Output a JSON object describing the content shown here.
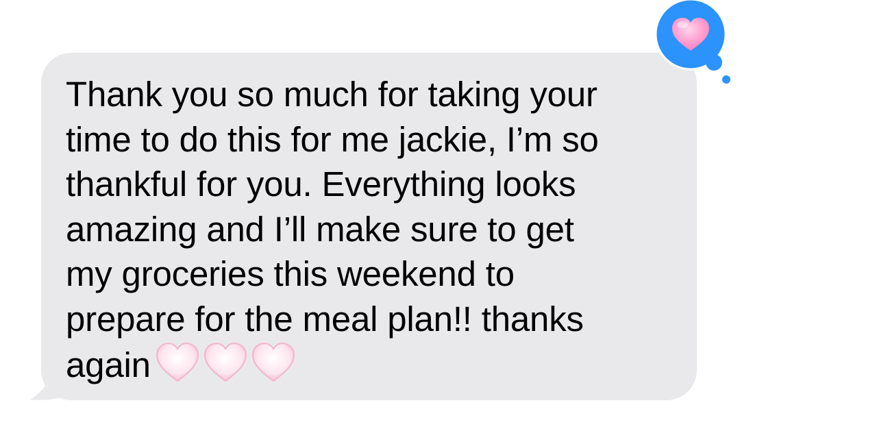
{
  "message": {
    "sender": "incoming",
    "lines": [
      "Thank you so much for taking your",
      "time to do this for me jackie, I’m so",
      "thankful for you. Everything looks",
      "amazing and I’ll make sure to get",
      "my groceries this weekend to",
      "prepare for the meal plan!! thanks",
      "again"
    ],
    "emoji": [
      "pink-heart-icon",
      "pink-heart-icon",
      "pink-heart-icon"
    ],
    "bubble_color": "#e9e9eb",
    "text_color": "#000000"
  },
  "tapback": {
    "reaction": "heart-icon",
    "badge_color": "#2b93fb",
    "heart_color": "#ff8fc8"
  }
}
